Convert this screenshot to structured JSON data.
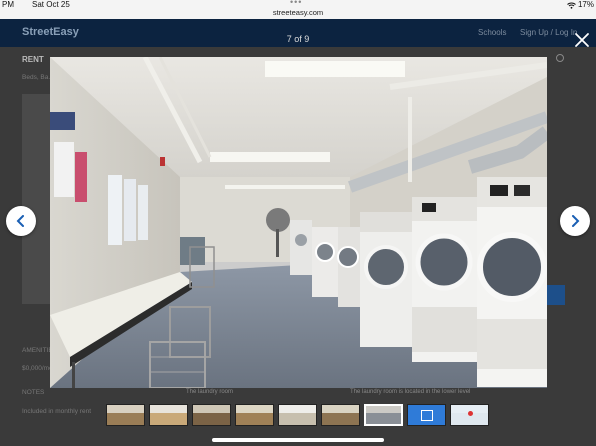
{
  "status_bar": {
    "time": "PM",
    "date": "Sat Oct 25",
    "url": "streeteasy.com",
    "battery": "17%",
    "wifi_icon": "wifi-icon"
  },
  "background_page": {
    "logo": "StreetEasy",
    "nav_schools": "Schools",
    "nav_login": "Sign Up / Log In",
    "rent_label": "RENT",
    "line1": "Beds, Ba...",
    "line2": "AMENITIES",
    "line3": "$0,000/mo",
    "line4": "NOTES",
    "line5": "Included in monthly rent"
  },
  "gallery": {
    "counter": "7 of 9",
    "caption_left": "The laundry room",
    "caption_right": "The laundry room is located in the lower level",
    "thumbnails": [
      {
        "name": "living-room",
        "top": "#d8d0c0",
        "bottom": "#9a7d56",
        "active": false
      },
      {
        "name": "bedroom",
        "top": "#e8e4dc",
        "bottom": "#c9a979",
        "active": false
      },
      {
        "name": "kitchen",
        "top": "#cfc7b6",
        "bottom": "#7b6346",
        "active": false
      },
      {
        "name": "dining",
        "top": "#ddd6c4",
        "bottom": "#a08157",
        "active": false
      },
      {
        "name": "bathroom",
        "top": "#efeeea",
        "bottom": "#c7bfae",
        "active": false
      },
      {
        "name": "hallway",
        "top": "#d9d3c2",
        "bottom": "#8d7452",
        "active": false
      },
      {
        "name": "laundry",
        "top": "#cccac5",
        "bottom": "#8a8f96",
        "active": true
      },
      {
        "name": "floorplan",
        "top": "#2f7bd8",
        "bottom": "#2f7bd8",
        "active": false
      },
      {
        "name": "map",
        "top": "#e6eef4",
        "bottom": "#dfe8ef",
        "active": false
      }
    ]
  },
  "colors": {
    "accent": "#2f7bd8",
    "nav_bg": "#0c2340"
  }
}
